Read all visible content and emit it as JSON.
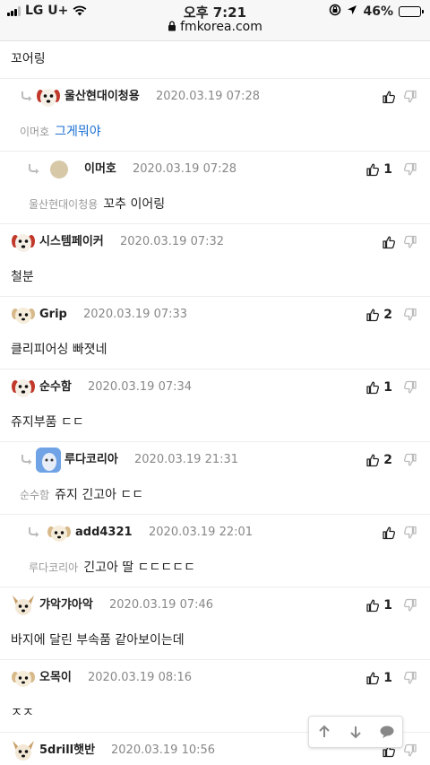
{
  "statusbar": {
    "carrier": "LG U+",
    "time": "오후 7:21",
    "battery": "46%",
    "battery_level": 0.46,
    "url": "fmkorea.com"
  },
  "comments": [
    {
      "kind": "content",
      "depth": 0,
      "reply_to": "",
      "text": "꼬어링",
      "link": false
    },
    {
      "kind": "header",
      "depth": 1,
      "nick": "울산현대이청용",
      "date": "2020.03.19 07:28",
      "likes": "",
      "avatar": "dog-red"
    },
    {
      "kind": "content",
      "depth": 1,
      "reply_to": "이머호",
      "text": "그게뭐야",
      "link": true
    },
    {
      "kind": "header",
      "depth": 2,
      "nick": "이머호",
      "date": "2020.03.19 07:28",
      "likes": "1",
      "avatar": "beige-circle"
    },
    {
      "kind": "content",
      "depth": 2,
      "reply_to": "울산현대이청용",
      "text": "꼬추 이어링",
      "link": false
    },
    {
      "kind": "header",
      "depth": 0,
      "nick": "시스템페이커",
      "date": "2020.03.19 07:32",
      "likes": "",
      "avatar": "dog-red"
    },
    {
      "kind": "content",
      "depth": 0,
      "reply_to": "",
      "text": "철분",
      "link": false
    },
    {
      "kind": "header",
      "depth": 0,
      "nick": "Grip",
      "date": "2020.03.19 07:33",
      "likes": "2",
      "avatar": "dog-beige"
    },
    {
      "kind": "content",
      "depth": 0,
      "reply_to": "",
      "text": "클리피어싱 빠졋네",
      "link": false
    },
    {
      "kind": "header",
      "depth": 0,
      "nick": "순수함",
      "date": "2020.03.19 07:34",
      "likes": "1",
      "avatar": "dog-red"
    },
    {
      "kind": "content",
      "depth": 0,
      "reply_to": "",
      "text": "쥬지부품 ㄷㄷ",
      "link": false
    },
    {
      "kind": "header",
      "depth": 1,
      "nick": "루다코리아",
      "date": "2020.03.19 21:31",
      "likes": "2",
      "avatar": "blue-photo"
    },
    {
      "kind": "content",
      "depth": 1,
      "reply_to": "순수함",
      "text": "쥬지 긴고아 ㄷㄷ",
      "link": false
    },
    {
      "kind": "header",
      "depth": 2,
      "nick": "add4321",
      "date": "2020.03.19 22:01",
      "likes": "",
      "avatar": "dog-beige"
    },
    {
      "kind": "content",
      "depth": 2,
      "reply_to": "루다코리아",
      "text": "긴고아 딸 ㄷㄷㄷㄷㄷ",
      "link": false
    },
    {
      "kind": "header",
      "depth": 0,
      "nick": "갸악갸아악",
      "date": "2020.03.19 07:46",
      "likes": "1",
      "avatar": "chihuahua"
    },
    {
      "kind": "content",
      "depth": 0,
      "reply_to": "",
      "text": "바지에 달린 부속품 같아보이는데",
      "link": false
    },
    {
      "kind": "header",
      "depth": 0,
      "nick": "오목이",
      "date": "2020.03.19 08:16",
      "likes": "1",
      "avatar": "dog-beige"
    },
    {
      "kind": "content",
      "depth": 0,
      "reply_to": "",
      "text": "ㅈㅈ",
      "link": false
    },
    {
      "kind": "header",
      "depth": 0,
      "nick": "5drill햇반",
      "date": "2020.03.19 10:56",
      "likes": "",
      "avatar": "chihuahua"
    }
  ],
  "colors": {
    "link": "#1a6fd2",
    "meta": "#888888",
    "divider": "#ededed"
  },
  "icons": {
    "like": "thumbs-up-icon",
    "dislike": "thumbs-down-icon",
    "reply": "reply-arrow-icon",
    "up": "arrow-up-icon",
    "down": "arrow-down-icon",
    "comment": "speech-bubble-icon"
  }
}
